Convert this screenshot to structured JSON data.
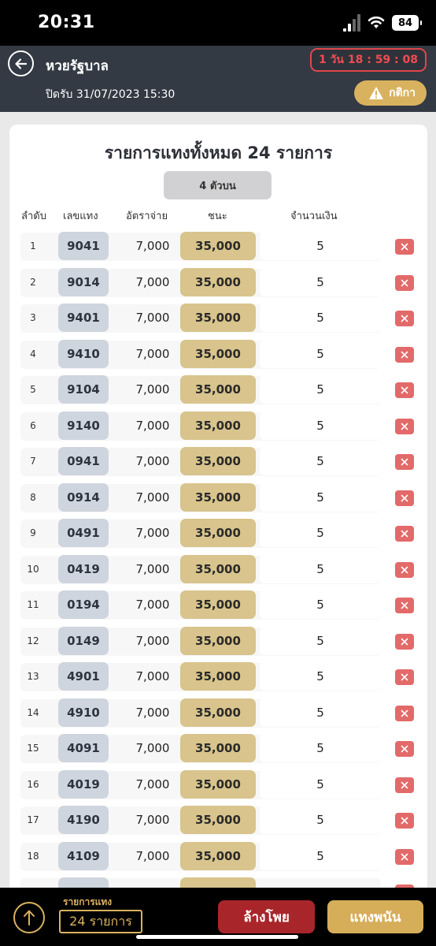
{
  "status_bar": {
    "time": "20:31",
    "battery": "84"
  },
  "header": {
    "title": "หวยรัฐบาล",
    "close_date": "ปิดรับ 31/07/2023 15:30",
    "countdown": "1 วัน 18 : 59 : 08",
    "rules_label": "กติกา"
  },
  "card": {
    "title": "รายการแทงทั้งหมด 24 รายการ",
    "bet_type": "4 ตัวบน",
    "columns": {
      "index": "ลำดับ",
      "number": "เลขแทง",
      "rate": "อัตราจ่าย",
      "win": "ชนะ",
      "amount": "จำนวนเงิน"
    }
  },
  "rows": [
    {
      "index": "1",
      "number": "9041",
      "rate": "7,000",
      "win": "35,000",
      "amount": "5"
    },
    {
      "index": "2",
      "number": "9014",
      "rate": "7,000",
      "win": "35,000",
      "amount": "5"
    },
    {
      "index": "3",
      "number": "9401",
      "rate": "7,000",
      "win": "35,000",
      "amount": "5"
    },
    {
      "index": "4",
      "number": "9410",
      "rate": "7,000",
      "win": "35,000",
      "amount": "5"
    },
    {
      "index": "5",
      "number": "9104",
      "rate": "7,000",
      "win": "35,000",
      "amount": "5"
    },
    {
      "index": "6",
      "number": "9140",
      "rate": "7,000",
      "win": "35,000",
      "amount": "5"
    },
    {
      "index": "7",
      "number": "0941",
      "rate": "7,000",
      "win": "35,000",
      "amount": "5"
    },
    {
      "index": "8",
      "number": "0914",
      "rate": "7,000",
      "win": "35,000",
      "amount": "5"
    },
    {
      "index": "9",
      "number": "0491",
      "rate": "7,000",
      "win": "35,000",
      "amount": "5"
    },
    {
      "index": "10",
      "number": "0419",
      "rate": "7,000",
      "win": "35,000",
      "amount": "5"
    },
    {
      "index": "11",
      "number": "0194",
      "rate": "7,000",
      "win": "35,000",
      "amount": "5"
    },
    {
      "index": "12",
      "number": "0149",
      "rate": "7,000",
      "win": "35,000",
      "amount": "5"
    },
    {
      "index": "13",
      "number": "4901",
      "rate": "7,000",
      "win": "35,000",
      "amount": "5"
    },
    {
      "index": "14",
      "number": "4910",
      "rate": "7,000",
      "win": "35,000",
      "amount": "5"
    },
    {
      "index": "15",
      "number": "4091",
      "rate": "7,000",
      "win": "35,000",
      "amount": "5"
    },
    {
      "index": "16",
      "number": "4019",
      "rate": "7,000",
      "win": "35,000",
      "amount": "5"
    },
    {
      "index": "17",
      "number": "4190",
      "rate": "7,000",
      "win": "35,000",
      "amount": "5"
    },
    {
      "index": "18",
      "number": "4109",
      "rate": "7,000",
      "win": "35,000",
      "amount": "5"
    },
    {
      "index": "",
      "number": "",
      "rate": "",
      "win": "",
      "amount": ""
    }
  ],
  "bottom_bar": {
    "list_label": "รายการแทง",
    "list_count": "24 รายการ",
    "clear_label": "ล้างโพย",
    "submit_label": "แทงพนัน"
  },
  "colors": {
    "header_bg": "#333a44",
    "gold": "#d9b25f",
    "danger": "#e36a6a",
    "clear_button": "#a8262a",
    "number_chip": "#cfd5de",
    "win_chip": "#d8c48c"
  }
}
